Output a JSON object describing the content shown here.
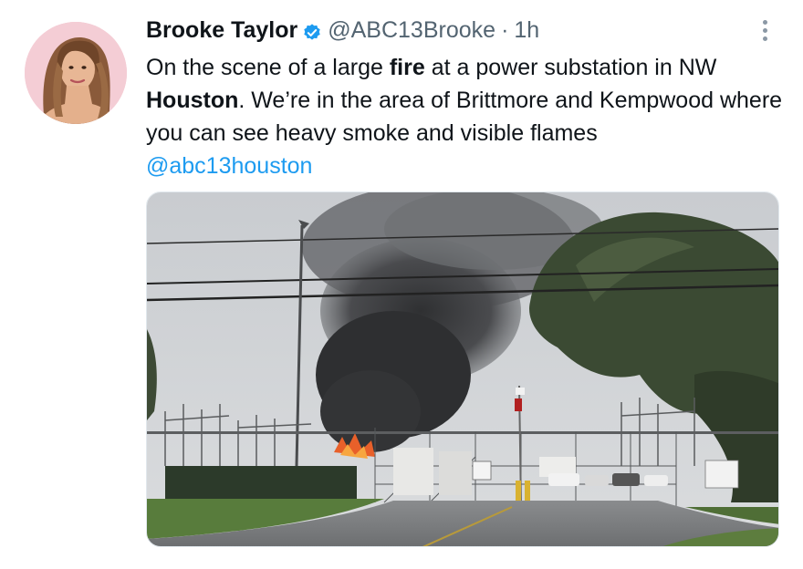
{
  "tweet": {
    "author_name": "Brooke Taylor",
    "handle": "@ABC13Brooke",
    "separator": "·",
    "time": "1h",
    "text_parts": [
      "On the scene of a large ",
      "fire",
      " at a power substation in NW ",
      "Houston",
      ". We’re in the area of Brittmore and Kempwood where you can see heavy smoke and visible flames"
    ],
    "mention": "@abc13houston"
  },
  "icons": {
    "verified": "verified-badge-icon",
    "more": "more-options-icon"
  },
  "colors": {
    "text": "#0f1419",
    "secondary": "#536471",
    "link": "#1d9bf0",
    "verified": "#1d9bf0"
  }
}
